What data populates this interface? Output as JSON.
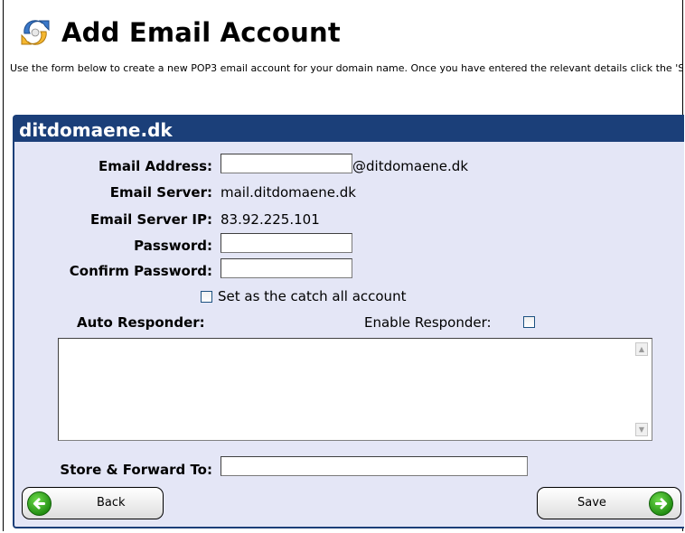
{
  "header": {
    "title": "Add Email Account",
    "icon": "refresh-arrows-icon",
    "intro": "Use the form below to create a new POP3 email account for your domain name. Once you have entered the relevant details click the 'Save' button to create the account."
  },
  "panel": {
    "domain": "ditdomaene.dk"
  },
  "form": {
    "email_address_label": "Email Address:",
    "email_address_value": "",
    "email_suffix": "@ditdomaene.dk",
    "email_server_label": "Email Server:",
    "email_server_value": "mail.ditdomaene.dk",
    "email_server_ip_label": "Email Server IP:",
    "email_server_ip_value": "83.92.225.101",
    "password_label": "Password:",
    "password_value": "",
    "confirm_password_label": "Confirm Password:",
    "confirm_password_value": "",
    "catch_all_label": "Set as the catch all account",
    "catch_all_checked": false,
    "auto_responder_label": "Auto Responder:",
    "enable_responder_label": "Enable Responder:",
    "enable_responder_checked": false,
    "auto_responder_text": "",
    "store_forward_label": "Store & Forward To:",
    "store_forward_value": ""
  },
  "buttons": {
    "back_label": "Back",
    "save_label": "Save",
    "back_icon": "arrow-left-icon",
    "save_icon": "arrow-right-icon"
  },
  "colors": {
    "panel_header": "#1b3f79",
    "panel_bg": "#e4e6f6",
    "button_icon": "#2a9a16"
  }
}
